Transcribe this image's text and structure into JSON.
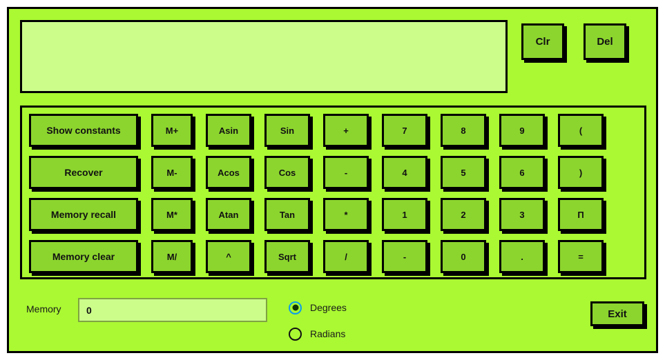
{
  "window": {
    "background_color": "#aaf932",
    "border_color": "#000000"
  },
  "display": {
    "value": "",
    "placeholder": "",
    "background_color": "#ccfd8b"
  },
  "top_keys": [
    {
      "label": "Clr",
      "name": "clear-button"
    },
    {
      "label": "Del",
      "name": "delete-button"
    }
  ],
  "keypad": {
    "button_color": "#8cd52e",
    "rows": [
      [
        {
          "label": "Show constants",
          "name": "show-constants-button",
          "wide": true
        },
        {
          "label": "M+",
          "name": "memory-add-button"
        },
        {
          "label": "Asin",
          "name": "asin-button"
        },
        {
          "label": "Sin",
          "name": "sin-button"
        },
        {
          "label": "+",
          "name": "plus-button"
        },
        {
          "label": "7",
          "name": "digit-7-button"
        },
        {
          "label": "8",
          "name": "digit-8-button"
        },
        {
          "label": "9",
          "name": "digit-9-button"
        },
        {
          "label": "(",
          "name": "open-paren-button"
        }
      ],
      [
        {
          "label": "Recover",
          "name": "recover-button",
          "wide": true
        },
        {
          "label": "M-",
          "name": "memory-subtract-button"
        },
        {
          "label": "Acos",
          "name": "acos-button"
        },
        {
          "label": "Cos",
          "name": "cos-button"
        },
        {
          "label": "-",
          "name": "minus-button"
        },
        {
          "label": "4",
          "name": "digit-4-button"
        },
        {
          "label": "5",
          "name": "digit-5-button"
        },
        {
          "label": "6",
          "name": "digit-6-button"
        },
        {
          "label": ")",
          "name": "close-paren-button"
        }
      ],
      [
        {
          "label": "Memory recall",
          "name": "memory-recall-button",
          "wide": true
        },
        {
          "label": "M*",
          "name": "memory-multiply-button"
        },
        {
          "label": "Atan",
          "name": "atan-button"
        },
        {
          "label": "Tan",
          "name": "tan-button"
        },
        {
          "label": "*",
          "name": "multiply-button"
        },
        {
          "label": "1",
          "name": "digit-1-button"
        },
        {
          "label": "2",
          "name": "digit-2-button"
        },
        {
          "label": "3",
          "name": "digit-3-button"
        },
        {
          "label": "П",
          "name": "pi-button"
        }
      ],
      [
        {
          "label": "Memory clear",
          "name": "memory-clear-button",
          "wide": true
        },
        {
          "label": "M/",
          "name": "memory-divide-button"
        },
        {
          "label": "^",
          "name": "power-button"
        },
        {
          "label": "Sqrt",
          "name": "sqrt-button"
        },
        {
          "label": "/",
          "name": "divide-button"
        },
        {
          "label": "-",
          "name": "negate-button"
        },
        {
          "label": "0",
          "name": "digit-0-button"
        },
        {
          "label": ".",
          "name": "decimal-point-button"
        },
        {
          "label": "=",
          "name": "equals-button"
        }
      ]
    ]
  },
  "footer": {
    "memory_label": "Memory",
    "memory_value": "0",
    "angle_modes": [
      {
        "label": "Degrees",
        "checked": true,
        "name": "radio-degrees"
      },
      {
        "label": "Radians",
        "checked": false,
        "name": "radio-radians"
      }
    ],
    "exit_label": "Exit",
    "selected_radio_ring_color": "#0e9ce8"
  }
}
